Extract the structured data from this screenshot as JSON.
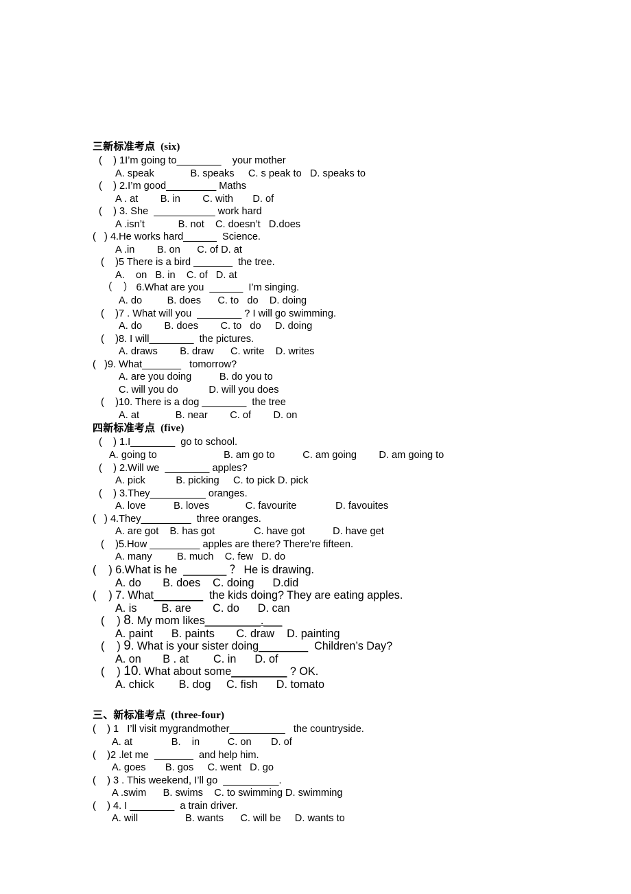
{
  "document": {
    "sections": [
      {
        "id": "section-six",
        "heading": "三新标准考点  (six)",
        "lines": [
          {
            "type": "question",
            "indent": 9,
            "text": "(    ) 1I’m going to",
            "blank": "________",
            "tail": "    your mother"
          },
          {
            "type": "options",
            "indent": 33,
            "text": "A. speak             B. speaks     C. s peak to   D. speaks to"
          },
          {
            "type": "question",
            "indent": 9,
            "text": "(    ) 2.I’m good",
            "blank": "_________",
            "tail": " Maths"
          },
          {
            "type": "options",
            "indent": 33,
            "text": "A . at        B. in        C. with       D. of"
          },
          {
            "type": "question",
            "indent": 9,
            "text": "(    ) 3. She  ",
            "blank": "___________",
            "tail": " work hard"
          },
          {
            "type": "options",
            "indent": 33,
            "text": "A .isn’t            B. not    C. doesn’t   D.does"
          },
          {
            "type": "question",
            "indent": 0,
            "text": "(   ) 4.He works hard",
            "blank": "______",
            "tail": "  Science."
          },
          {
            "type": "options",
            "indent": 33,
            "text": "A .in        B. on      C. of D. at"
          },
          {
            "type": "question",
            "indent": 12,
            "text": "(    )5 There is a bird ",
            "blank": "_______",
            "tail": "  the tree."
          },
          {
            "type": "options",
            "indent": 33,
            "text": "A.    on   B. in    C. of   D. at"
          },
          {
            "type": "question",
            "indent": 14,
            "text": "（    ） 6.What are you  ",
            "blank": "______",
            "tail": "  I’m singing."
          },
          {
            "type": "options",
            "indent": 38,
            "text": "A. do         B. does      C. to   do    D. doing"
          },
          {
            "type": "question",
            "indent": 12,
            "text": "(    )7 . What will you  ",
            "blank": "________",
            "tail": " ? I will go swimming."
          },
          {
            "type": "options",
            "indent": 38,
            "text": "A. do        B. does        C. to   do     D. doing"
          },
          {
            "type": "question",
            "indent": 12,
            "text": "(    )8. I will",
            "blank": "________",
            "tail": "  the pictures."
          },
          {
            "type": "options",
            "indent": 38,
            "text": "A. draws        B. draw      C. write    D. writes"
          },
          {
            "type": "question",
            "indent": 0,
            "text": "(   )9. What",
            "blank": "_______",
            "tail": "   tomorrow?"
          },
          {
            "type": "options",
            "indent": 38,
            "text": "A. are you doing          B. do you to"
          },
          {
            "type": "options",
            "indent": 38,
            "text": "C. will you do           D. will you does"
          },
          {
            "type": "question",
            "indent": 12,
            "text": "(    )10. There is a dog ",
            "blank": "________",
            "tail": "  the tree"
          },
          {
            "type": "options",
            "indent": 38,
            "text": "A. at             B. near        C. of        D. on"
          }
        ]
      },
      {
        "id": "section-five",
        "heading": "四新标准考点  (five)",
        "lines": [
          {
            "type": "question",
            "indent": 9,
            "text": "(    ) 1.I",
            "blank": "________",
            "tail": "  go to school."
          },
          {
            "type": "options",
            "indent": 24,
            "text": "A. going to                        B. am go to          C. am going        D. am going to"
          },
          {
            "type": "question",
            "indent": 9,
            "text": "(    ) 2.Will we  ",
            "blank": "________",
            "tail": " apples?"
          },
          {
            "type": "options",
            "indent": 33,
            "text": "A. pick           B. picking     C. to pick D. pick"
          },
          {
            "type": "question",
            "indent": 9,
            "text": "(    ) 3.They",
            "blank": "__________",
            "tail": " oranges."
          },
          {
            "type": "options",
            "indent": 33,
            "text": "A. love          B. loves             C. favourite              D. favouites"
          },
          {
            "type": "question",
            "indent": 0,
            "text": "(   ) 4.They",
            "blank": "_________",
            "tail": "  three oranges."
          },
          {
            "type": "options",
            "indent": 33,
            "text": "A. are got    B. has got              C. have got          D. have get"
          },
          {
            "type": "question",
            "indent": 12,
            "text": "(    )5.How ",
            "blank": "_________",
            "tail": " apples are there? There’re fifteen."
          },
          {
            "type": "options",
            "indent": 33,
            "text": "A. many         B. much    C. few   D. do"
          },
          {
            "type": "question",
            "indent": 0,
            "size": "md",
            "text": "(    ) 6.What is he  ",
            "blank": "_______",
            "tail": " ？ He is drawing."
          },
          {
            "type": "options",
            "indent": 33,
            "size": "md",
            "text": "A. do       B. does    C. doing      D.did"
          },
          {
            "type": "question",
            "indent": 0,
            "size": "md",
            "text": "(    ) 7. What",
            "blank": "________",
            "tail": "  the kids doing? They are eating apples."
          },
          {
            "type": "options",
            "indent": 33,
            "size": "md",
            "text": "A. is        B. are       C. do      D. can"
          },
          {
            "type": "question",
            "indent": 12,
            "size": "md",
            "num_big": true,
            "text": "(    ) 8. My mom likes",
            "blank": "_________.___",
            "tail": ""
          },
          {
            "type": "options",
            "indent": 33,
            "size": "md",
            "text": "A. paint      B. paints       C. draw    D. painting"
          },
          {
            "type": "question",
            "indent": 12,
            "size": "md",
            "num_big": true,
            "text": "(    ) 9. What is your sister doing",
            "blank": "________",
            "tail": "  Children’s Day?"
          },
          {
            "type": "options",
            "indent": 33,
            "size": "md",
            "text": "A. on       B . at        C. in      D. of"
          },
          {
            "type": "question",
            "indent": 12,
            "size": "md",
            "num_big": true,
            "text": "(    ) 10. What about some",
            "blank": "_________",
            "tail": " ? OK."
          },
          {
            "type": "options",
            "indent": 33,
            "size": "md",
            "text": "A. chick        B. dog     C. fish      D. tomato"
          }
        ]
      },
      {
        "id": "section-three-four",
        "heading": "三、新标准考点  (three-four)",
        "lines": [
          {
            "type": "question",
            "indent": 0,
            "text": "(    ) 1   I’ll visit mygrandmother",
            "blank": "__________",
            "tail": "   the countryside."
          },
          {
            "type": "options",
            "indent": 28,
            "text": "A. at              B.    in          C. on       D. of"
          },
          {
            "type": "question",
            "indent": 0,
            "text": "(    )2 .let me  ",
            "blank": "_______",
            "tail": "  and help him."
          },
          {
            "type": "options",
            "indent": 28,
            "text": "A. goes       B. gos     C. went   D. go"
          },
          {
            "type": "question",
            "indent": 0,
            "text": "(    ) 3 . This weekend, I’ll go  ",
            "blank": "__________",
            "tail": "."
          },
          {
            "type": "options",
            "indent": 28,
            "text": "A .swim      B. swims    C. to swimming D. swimming"
          },
          {
            "type": "question",
            "indent": 0,
            "text": "(    ) 4. I ",
            "blank": "________",
            "tail": "  a train driver."
          },
          {
            "type": "options",
            "indent": 28,
            "text": "A. will                 B. wants      C. will be     D. wants to"
          }
        ]
      }
    ]
  }
}
